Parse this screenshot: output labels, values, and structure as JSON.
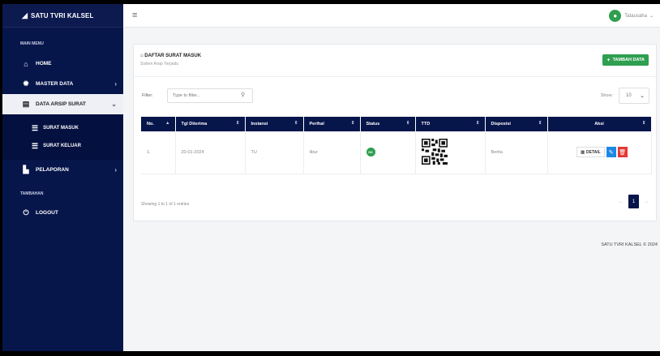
{
  "brand": {
    "title": "SATU TVRI KALSEL"
  },
  "sidebar": {
    "main_menu_label": "MAIN MENU",
    "extra_label": "TAMBAHAN",
    "items": [
      {
        "label": "HOME",
        "icon": "home-icon"
      },
      {
        "label": "MASTER DATA",
        "icon": "gear-icon"
      },
      {
        "label": "DATA ARSIP SURAT",
        "icon": "file-icon"
      },
      {
        "label": "PELAPORAN",
        "icon": "chart-icon"
      },
      {
        "label": "LOGOUT",
        "icon": "power-icon"
      }
    ],
    "submenu": [
      {
        "label": "SURAT MASUK",
        "icon": "list-icon"
      },
      {
        "label": "SURAT KELUAR",
        "icon": "list-icon"
      }
    ]
  },
  "topbar": {
    "username": "Tatausaha"
  },
  "page": {
    "title": "DAFTAR SURAT MASUK",
    "subtitle": "Sistem Arsip Terpadu",
    "add_button": "TAMBAH DATA",
    "filter_label": "Filter:",
    "filter_placeholder": "Type to filter...",
    "show_label": "Show:",
    "show_value": "10"
  },
  "table": {
    "headers": [
      "No.",
      "Tgl Diterima",
      "Instansi",
      "Perihal",
      "Status",
      "TTD",
      "Disposisi",
      "Aksi"
    ],
    "rows": [
      {
        "no": "1.",
        "tgl": "20-01-2024",
        "instansi": "TU",
        "perihal": "libur",
        "status": "OK",
        "disposisi": "Berita"
      }
    ],
    "detail_label": "DETAIL"
  },
  "pagination": {
    "entries": "Showing 1 to 1 of 1 entries",
    "prev": "←",
    "current": "1",
    "next": "→"
  },
  "footer": {
    "text": "SATU TVRI KALSEL © 2024"
  },
  "colors": {
    "navy": "#06154a",
    "green": "#2e9e4f",
    "blue": "#1e88e5",
    "red": "#e53935"
  }
}
